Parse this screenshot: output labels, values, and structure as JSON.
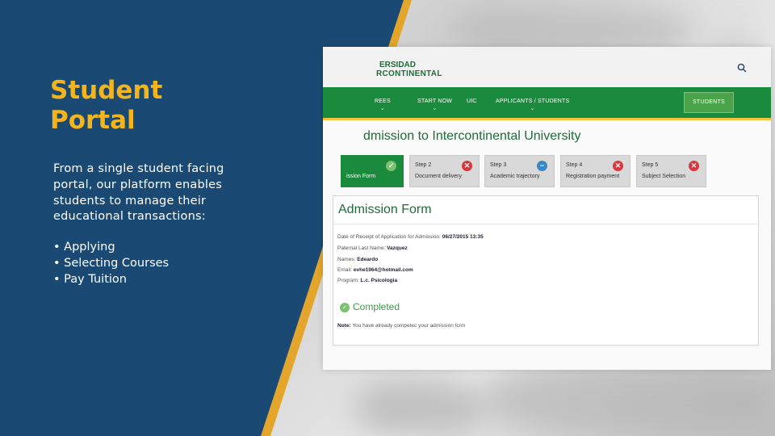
{
  "slide": {
    "title_line1": "Student",
    "title_line2": "Portal",
    "description": "From a single student facing portal, our platform enables students to manage their educational transactions:",
    "bullets": [
      "• Applying",
      "• Selecting Courses",
      "• Pay Tuition"
    ]
  },
  "colors": {
    "panel_blue": "#1a4a73",
    "accent_gold": "#f4b51c",
    "portal_green": "#1a8a3c"
  },
  "portal": {
    "logo_line1": "ERSIDAD",
    "logo_line2": "RCONTINENTAL",
    "search_icon": "search-icon",
    "nav": [
      {
        "label": "REES",
        "chev": "⌄"
      },
      {
        "label": "START NOW",
        "chev": "⌄"
      },
      {
        "label": "UIC",
        "chev": ""
      },
      {
        "label": "APPLICANTS / STUDENTS",
        "chev": "⌄"
      }
    ],
    "nav_button": "STUDENTS",
    "page_title": "dmission to Intercontinental University",
    "steps": [
      {
        "name": "",
        "label": "ission Form",
        "icon": "✓",
        "status": "check"
      },
      {
        "name": "Step 2",
        "label": "Document delivery",
        "icon": "✕",
        "status": "error"
      },
      {
        "name": "Step 3",
        "label": "Academic trajectory",
        "icon": "−",
        "status": "info"
      },
      {
        "name": "Step 4",
        "label": "Registration payment",
        "icon": "✕",
        "status": "error"
      },
      {
        "name": "Step 5",
        "label": "Subject Selection",
        "icon": "✕",
        "status": "error"
      }
    ],
    "form": {
      "title": "Admission Form",
      "fields": [
        {
          "label": "Date of Receipt of Application for Admission:",
          "value": "06/27/2015 13:35"
        },
        {
          "label": "Paternal Last Name:",
          "value": "Vazquez"
        },
        {
          "label": "Names:",
          "value": "Edeardo"
        },
        {
          "label": "Email:",
          "value": "evhe1964@hotmail.com"
        },
        {
          "label": "Program:",
          "value": "L.c. Psicologia"
        }
      ],
      "status": "Completed",
      "note_label": "Note:",
      "note_text": "You have already competec your admission fcrm"
    }
  }
}
